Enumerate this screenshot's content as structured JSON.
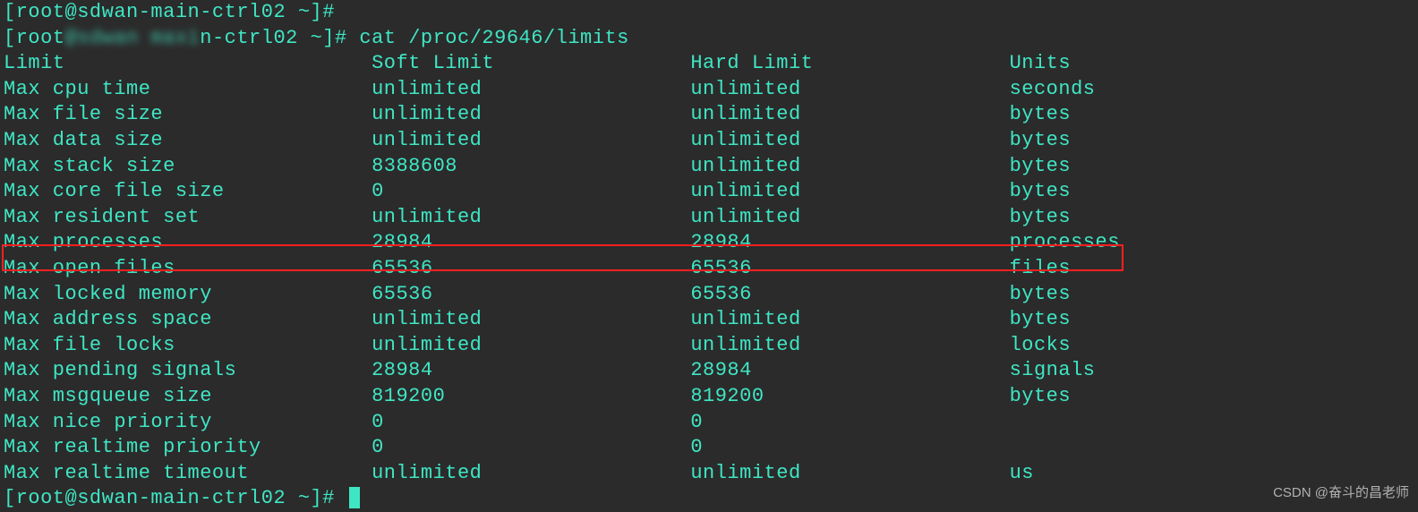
{
  "prompts": {
    "line0": "[root@sdwan-main-ctrl02 ~]#",
    "line1_a": "[root",
    "line1_blur": "@sdwan maxi",
    "line1_b": "n-ctrl02 ~]#",
    "line_last": "[root@sdwan-main-ctrl02 ~]#"
  },
  "command": " cat /proc/29646/limits",
  "header": {
    "limit": "Limit",
    "soft": "Soft Limit",
    "hard": "Hard Limit",
    "units": "Units"
  },
  "rows": [
    {
      "limit": "Max cpu time",
      "soft": "unlimited",
      "hard": "unlimited",
      "units": "seconds"
    },
    {
      "limit": "Max file size",
      "soft": "unlimited",
      "hard": "unlimited",
      "units": "bytes"
    },
    {
      "limit": "Max data size",
      "soft": "unlimited",
      "hard": "unlimited",
      "units": "bytes"
    },
    {
      "limit": "Max stack size",
      "soft": "8388608",
      "hard": "unlimited",
      "units": "bytes"
    },
    {
      "limit": "Max core file size",
      "soft": "0",
      "hard": "unlimited",
      "units": "bytes"
    },
    {
      "limit": "Max resident set",
      "soft": "unlimited",
      "hard": "unlimited",
      "units": "bytes"
    },
    {
      "limit": "Max processes",
      "soft": "28984",
      "hard": "28984",
      "units": "processes"
    },
    {
      "limit": "Max open files",
      "soft": "65536",
      "hard": "65536",
      "units": "files"
    },
    {
      "limit": "Max locked memory",
      "soft": "65536",
      "hard": "65536",
      "units": "bytes"
    },
    {
      "limit": "Max address space",
      "soft": "unlimited",
      "hard": "unlimited",
      "units": "bytes"
    },
    {
      "limit": "Max file locks",
      "soft": "unlimited",
      "hard": "unlimited",
      "units": "locks"
    },
    {
      "limit": "Max pending signals",
      "soft": "28984",
      "hard": "28984",
      "units": "signals"
    },
    {
      "limit": "Max msgqueue size",
      "soft": "819200",
      "hard": "819200",
      "units": "bytes"
    },
    {
      "limit": "Max nice priority",
      "soft": "0",
      "hard": "0",
      "units": ""
    },
    {
      "limit": "Max realtime priority",
      "soft": "0",
      "hard": "0",
      "units": ""
    },
    {
      "limit": "Max realtime timeout",
      "soft": "unlimited",
      "hard": "unlimited",
      "units": "us"
    }
  ],
  "watermark": "CSDN @奋斗的昌老师"
}
